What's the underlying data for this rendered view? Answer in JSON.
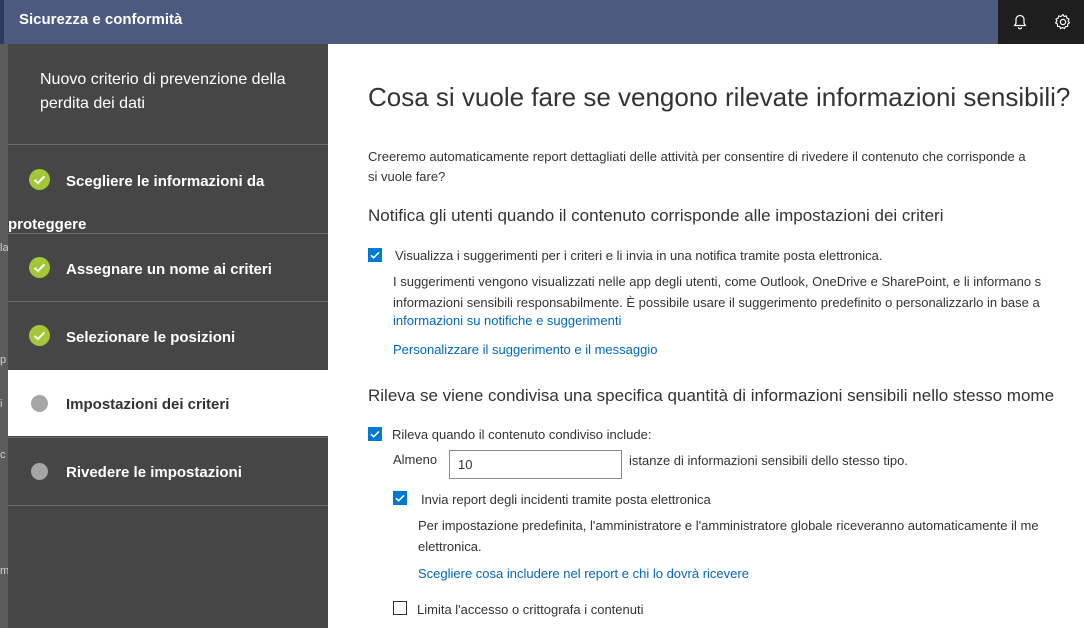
{
  "app": {
    "title": "Sicurezza e conformità"
  },
  "background_fragments": [
    "la",
    "p",
    "i",
    "c",
    "m"
  ],
  "wizard": {
    "title": "Nuovo criterio di prevenzione della perdita dei dati",
    "steps": [
      {
        "label_line1": "Scegliere le informazioni da",
        "label_line2": "proteggere",
        "status": "completed"
      },
      {
        "label": "Assegnare un nome ai criteri",
        "status": "completed"
      },
      {
        "label": "Selezionare le posizioni",
        "status": "completed"
      },
      {
        "label": "Impostazioni dei criteri",
        "status": "current"
      },
      {
        "label": "Rivedere le impostazioni",
        "status": "pending"
      }
    ]
  },
  "main": {
    "heading": "Cosa si vuole fare se vengono rilevate informazioni sensibili?",
    "intro_line1": "Creeremo automaticamente report dettagliati delle attività per consentire di rivedere il contenuto che corrisponde a",
    "intro_line2": "si vuole fare?",
    "notify": {
      "heading": "Notifica gli utenti quando il contenuto corrisponde alle impostazioni dei criteri",
      "checkbox_label": "Visualizza i suggerimenti per i criteri e li invia in una notifica tramite posta elettronica.",
      "checked": true,
      "desc_line1": "I suggerimenti vengono visualizzati nelle app degli utenti, come Outlook, OneDrive e SharePoint, e li informano s",
      "desc_line2": "informazioni sensibili responsabilmente. È possibile usare il suggerimento predefinito o personalizzarlo in base a",
      "info_link": "informazioni su notifiche e suggerimenti",
      "customize_link": "Personalizzare il suggerimento e il messaggio"
    },
    "detect": {
      "heading": "Rileva se viene condivisa una specifica quantità di informazioni sensibili nello stesso mome",
      "checkbox_label": "Rileva quando il contenuto condiviso include:",
      "checked": true,
      "almeno_label": "Almeno",
      "count_value": "10",
      "after_input": "istanze di informazioni sensibili dello stesso tipo.",
      "report_checkbox_label": "Invia report degli incidenti tramite posta elettronica",
      "report_checked": true,
      "report_desc_line1": "Per impostazione predefinita, l'amministratore e l'amministratore globale riceveranno automaticamente il me",
      "report_desc_line2": "elettronica.",
      "report_link": "Scegliere cosa includere nel report e chi lo dovrà ricevere",
      "restrict_checkbox_label": "Limita l'accesso o crittografa i contenuti",
      "restrict_checked": false
    }
  },
  "colors": {
    "topbar": "#4c5a80",
    "wizard_bg": "#464646",
    "check_green": "#a4c639",
    "accent_blue": "#0078d4",
    "link_blue": "#0067b8"
  }
}
